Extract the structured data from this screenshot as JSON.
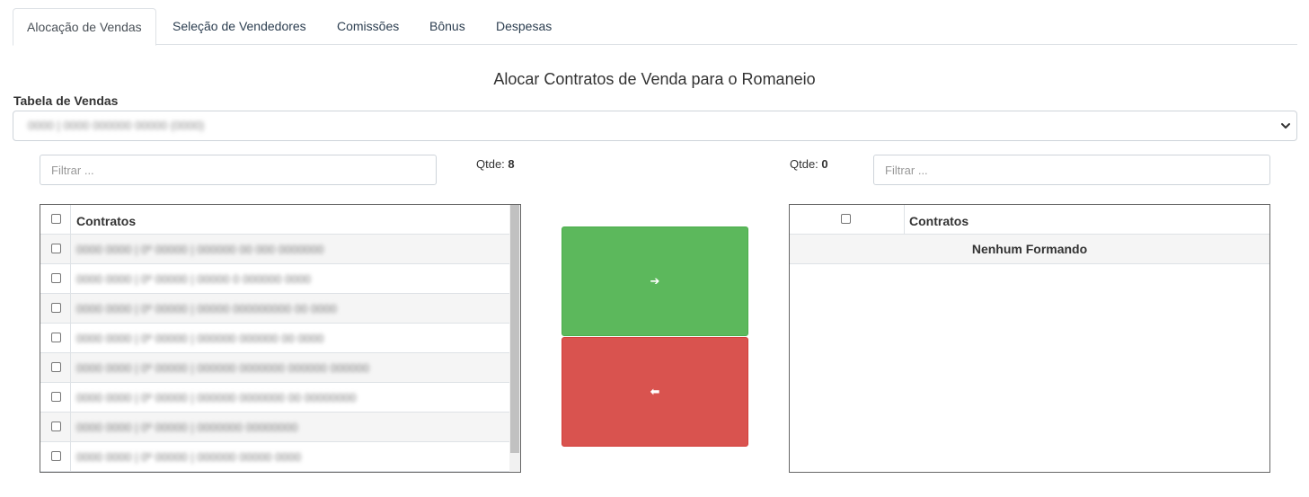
{
  "tabs": [
    {
      "label": "Alocação de Vendas",
      "active": true
    },
    {
      "label": "Seleção de Vendedores"
    },
    {
      "label": "Comissões"
    },
    {
      "label": "Bônus"
    },
    {
      "label": "Despesas"
    }
  ],
  "title": "Alocar Contratos de Venda para o Romaneio",
  "sales_table": {
    "label": "Tabela de Vendas",
    "selected_value": "0000 | 0000 000000 00000 (0000)"
  },
  "left": {
    "filter_placeholder": "Filtrar ...",
    "qtde_label": "Qtde:",
    "qtde_value": "8",
    "column_header": "Contratos",
    "rows": [
      "0000 0000 | 0º 00000 | 000000 00 000 0000000",
      "0000 0000 | 0º 00000 | 00000 0 000000 0000",
      "0000 0000 | 0º 00000 | 00000 000000000 00 0000",
      "0000 0000 | 0º 00000 | 000000 000000 00 0000",
      "0000 0000 | 0º 00000 | 000000 0000000 000000 000000",
      "0000 0000 | 0º 00000 | 000000 0000000 00 00000000",
      "0000 0000 | 0º 00000 | 0000000 00000000",
      "0000 0000 | 0º 00000 | 000000 00000 0000"
    ]
  },
  "right": {
    "filter_placeholder": "Filtrar ...",
    "qtde_label": "Qtde:",
    "qtde_value": "0",
    "column_header": "Contratos",
    "empty_message": "Nenhum Formando"
  },
  "buttons": {
    "move_right_icon": "arrow-right-icon",
    "move_left_icon": "arrow-left-icon",
    "move_right_symbol": "➔",
    "move_left_symbol": "⬅",
    "green": "#5cb85c",
    "red": "#d9534f"
  }
}
